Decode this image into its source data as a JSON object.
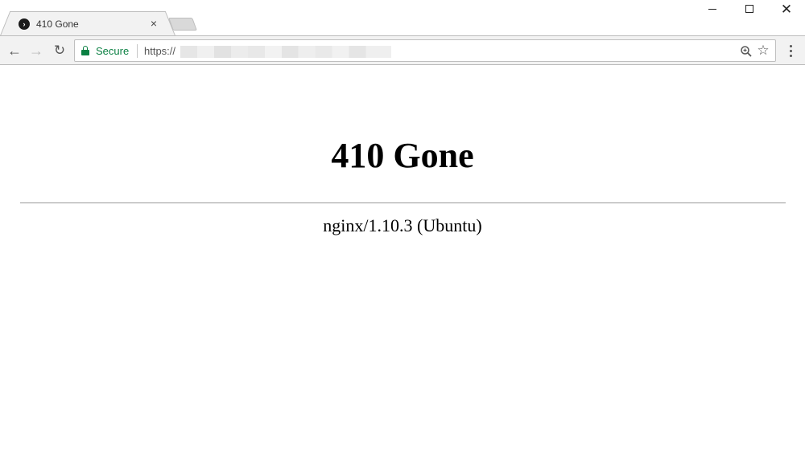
{
  "browser": {
    "tab": {
      "title": "410 Gone",
      "favicon_glyph": "›",
      "close_glyph": "×"
    },
    "window_controls": {
      "close_glyph": "✕"
    },
    "toolbar": {
      "back_glyph": "←",
      "forward_glyph": "→",
      "reload_glyph": "↻",
      "star_glyph": "☆"
    },
    "omnibox": {
      "secure_label": "Secure",
      "url_scheme": "https://",
      "security_color": "#0b8043"
    }
  },
  "page": {
    "heading": "410 Gone",
    "server_signature": "nginx/1.10.3 (Ubuntu)"
  }
}
